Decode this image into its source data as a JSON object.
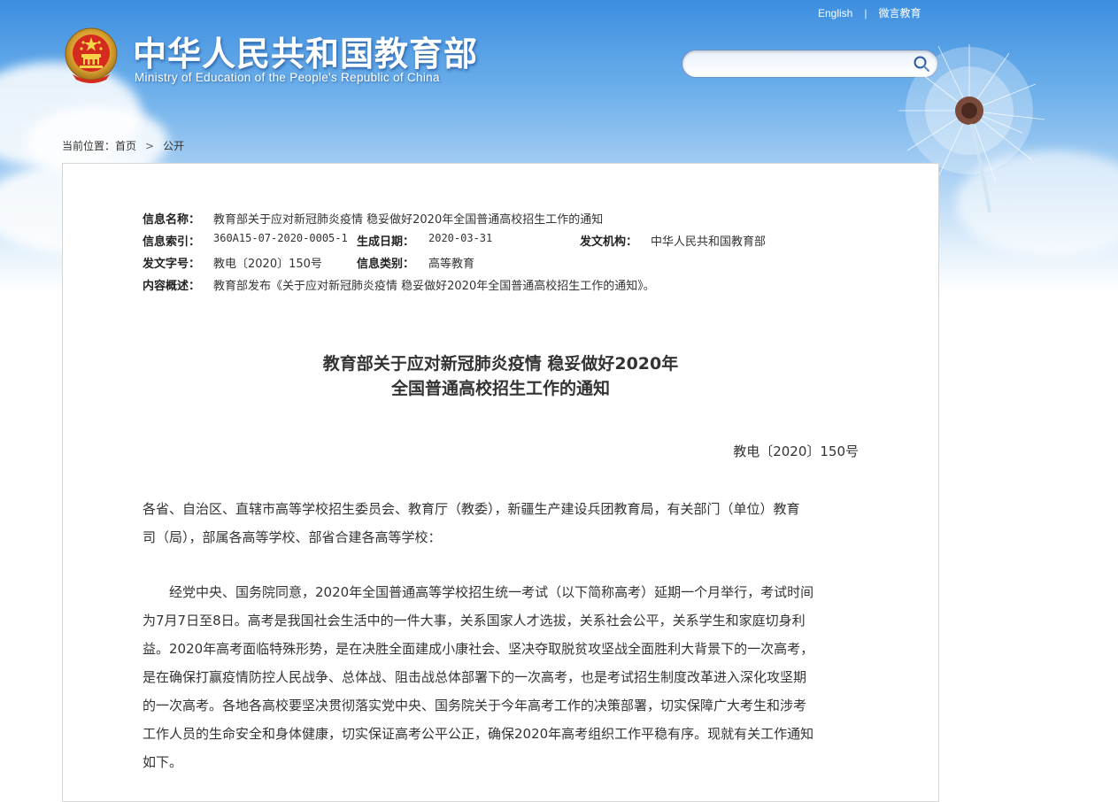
{
  "header": {
    "top_links": [
      "English",
      "微言教育"
    ],
    "title_cn": "中华人民共和国教育部",
    "title_en": "Ministry of Education of the People's Republic of China",
    "search_placeholder": ""
  },
  "breadcrumb": {
    "prefix": "当前位置：",
    "items": [
      "首页",
      "公开"
    ],
    "separator": ">"
  },
  "meta": {
    "name_label": "信息名称：",
    "name_value": "教育部关于应对新冠肺炎疫情 稳妥做好2020年全国普通高校招生工作的通知",
    "index_label": "信息索引：",
    "index_value": "360A15-07-2020-0005-1",
    "date_label": "生成日期：",
    "date_value": "2020-03-31",
    "issuer_label": "发文机构：",
    "issuer_value": "中华人民共和国教育部",
    "docno_label": "发文字号：",
    "docno_value": "教电〔2020〕150号",
    "category_label": "信息类别：",
    "category_value": "高等教育",
    "summary_label": "内容概述：",
    "summary_value": "教育部发布《关于应对新冠肺炎疫情 稳妥做好2020年全国普通高校招生工作的通知》。"
  },
  "document": {
    "title_lines": [
      "教育部关于应对新冠肺炎疫情 稳妥做好2020年",
      "全国普通高校招生工作的通知"
    ],
    "doc_number": "教电〔2020〕150号",
    "recipients_lines": [
      "各省、自治区、直辖市高等学校招生委员会、教育厅（教委），新疆生产建设兵团教育局，有关部门（单位）教育",
      "司（局），部属各高等学校、部省合建各高等学校："
    ],
    "body_lines": [
      "　　经党中央、国务院同意，2020年全国普通高等学校招生统一考试（以下简称高考）延期一个月举行，考试时间",
      "为7月7日至8日。高考是我国社会生活中的一件大事，关系国家人才选拔，关系社会公平，关系学生和家庭切身利",
      "益。2020年高考面临特殊形势，是在决胜全面建成小康社会、坚决夺取脱贫攻坚战全面胜利大背景下的一次高考，",
      "是在确保打赢疫情防控人民战争、总体战、阻击战总体部署下的一次高考，也是考试招生制度改革进入深化攻坚期",
      "的一次高考。各地各高校要坚决贯彻落实党中央、国务院关于今年高考工作的决策部署，切实保障广大考生和涉考",
      "工作人员的生命安全和身体健康，切实保证高考公平公正，确保2020年高考组织工作平稳有序。现就有关工作通知",
      "如下。"
    ]
  },
  "icons": [
    "national-emblem-icon",
    "search-icon",
    "dandelion-decoration"
  ]
}
